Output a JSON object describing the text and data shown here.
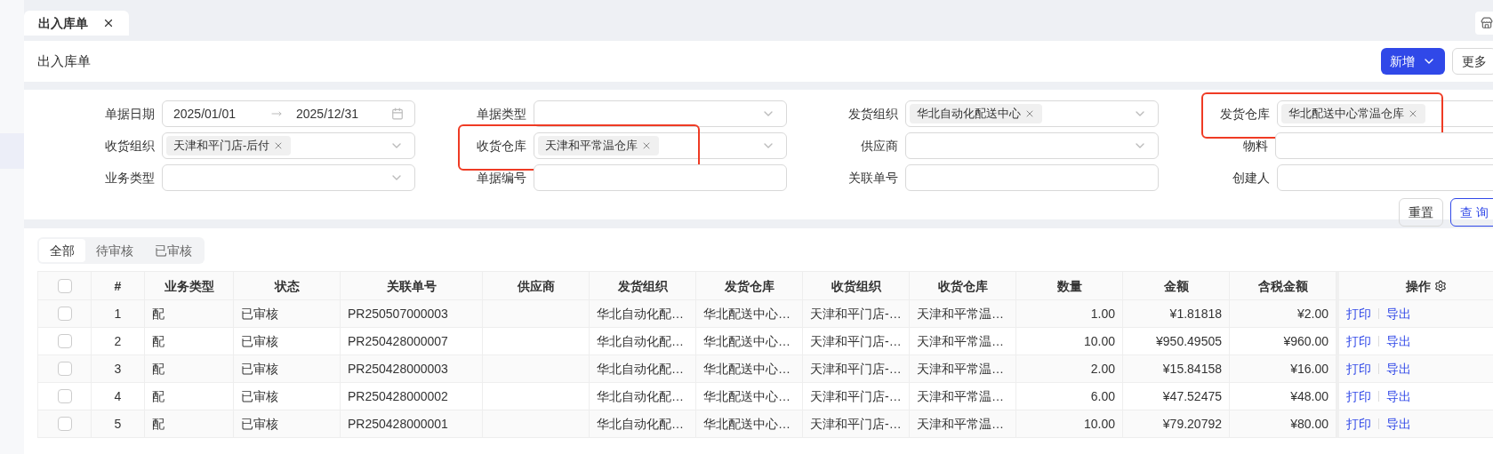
{
  "tabs": [
    {
      "label": "出入库单",
      "selected": true
    }
  ],
  "header": {
    "title": "出入库单",
    "buttons": [
      {
        "label": "新增",
        "kind": "primary-dropdown"
      },
      {
        "label": "更多",
        "kind": "default"
      }
    ]
  },
  "filters": [
    {
      "label": "单据日期",
      "kind": "date-range",
      "start": "2025/01/01",
      "end": "2025/12/31",
      "highlighted": false
    },
    {
      "label": "单据类型",
      "kind": "select",
      "highlighted": false
    },
    {
      "label": "发货组织",
      "kind": "select",
      "tags": [
        "华北自动化配送中心"
      ],
      "highlighted": false
    },
    {
      "label": "发货仓库",
      "kind": "select",
      "tags": [
        "华北配送中心常温仓库"
      ],
      "highlighted": true
    },
    {
      "label": "收货组织",
      "kind": "select",
      "tags": [
        "天津和平门店-后付"
      ],
      "highlighted": false
    },
    {
      "label": "收货仓库",
      "kind": "select",
      "tags": [
        "天津和平常温仓库"
      ],
      "highlighted": true
    },
    {
      "label": "供应商",
      "kind": "select",
      "highlighted": false
    },
    {
      "label": "物料",
      "kind": "select-addon",
      "highlighted": false
    },
    {
      "label": "业务类型",
      "kind": "select",
      "highlighted": false
    },
    {
      "label": "单据编号",
      "kind": "input",
      "highlighted": false
    },
    {
      "label": "关联单号",
      "kind": "input",
      "highlighted": false
    },
    {
      "label": "创建人",
      "kind": "input",
      "highlighted": false
    }
  ],
  "filter_buttons": [
    {
      "label": "重置",
      "kind": "default"
    },
    {
      "label": "查 询",
      "kind": "primary-outline"
    }
  ],
  "status_tabs": [
    {
      "label": "全部",
      "selected": true
    },
    {
      "label": "待审核",
      "selected": false
    },
    {
      "label": "已审核",
      "selected": false
    }
  ],
  "table": {
    "all_checked": false,
    "columns": [
      "#",
      "业务类型",
      "状态",
      "关联单号",
      "供应商",
      "发货组织",
      "发货仓库",
      "收货组织",
      "收货仓库",
      "数量",
      "金额",
      "含税金额",
      "操作"
    ],
    "rows": [
      {
        "checked": false,
        "cells": [
          "1",
          "配",
          "已审核",
          "PR250507000003",
          "",
          "华北自动化配…",
          "华北配送中心…",
          "天津和平门店-…",
          "天津和平常温…",
          "1.00",
          "¥1.81818",
          "¥2.00"
        ],
        "actions": [
          "打印",
          "导出"
        ]
      },
      {
        "checked": false,
        "cells": [
          "2",
          "配",
          "已审核",
          "PR250428000007",
          "",
          "华北自动化配…",
          "华北配送中心…",
          "天津和平门店-…",
          "天津和平常温…",
          "10.00",
          "¥950.49505",
          "¥960.00"
        ],
        "actions": [
          "打印",
          "导出"
        ]
      },
      {
        "checked": false,
        "cells": [
          "3",
          "配",
          "已审核",
          "PR250428000003",
          "",
          "华北自动化配…",
          "华北配送中心…",
          "天津和平门店-…",
          "天津和平常温…",
          "2.00",
          "¥15.84158",
          "¥16.00"
        ],
        "actions": [
          "打印",
          "导出"
        ]
      },
      {
        "checked": false,
        "cells": [
          "4",
          "配",
          "已审核",
          "PR250428000002",
          "",
          "华北自动化配…",
          "华北配送中心…",
          "天津和平门店-…",
          "天津和平常温…",
          "6.00",
          "¥47.52475",
          "¥48.00"
        ],
        "actions": [
          "打印",
          "导出"
        ]
      },
      {
        "checked": false,
        "cells": [
          "5",
          "配",
          "已审核",
          "PR250428000001",
          "",
          "华北自动化配…",
          "华北配送中心…",
          "天津和平门店-…",
          "天津和平常温…",
          "10.00",
          "¥79.20792",
          "¥80.00"
        ],
        "actions": [
          "打印",
          "导出"
        ]
      }
    ]
  }
}
